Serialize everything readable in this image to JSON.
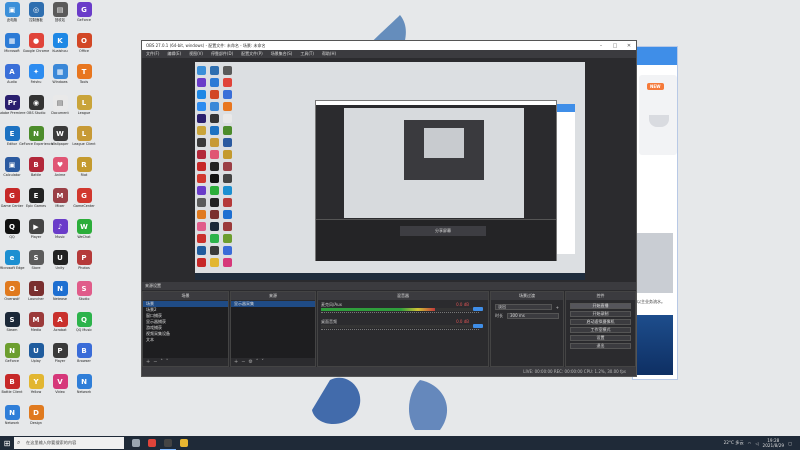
{
  "desktop": {
    "icons": [
      {
        "label": "此电脑",
        "color": "#3b8fd9",
        "glyph": "▣"
      },
      {
        "label": "控制面板",
        "color": "#2f6fb0",
        "glyph": "◎"
      },
      {
        "label": "回收站",
        "color": "#5a5a5a",
        "glyph": "▤"
      },
      {
        "label": "GeForce",
        "color": "#6a3cc9",
        "glyph": "G"
      },
      {
        "label": "Microsoft",
        "color": "#2c7bd6",
        "glyph": "▦"
      },
      {
        "label": "Google Chrome",
        "color": "#e0443a",
        "glyph": "●"
      },
      {
        "label": "Kuaishou",
        "color": "#1e88e5",
        "glyph": "K"
      },
      {
        "label": "Office",
        "color": "#d24726",
        "glyph": "O"
      },
      {
        "label": "Audio",
        "color": "#3a6fd8",
        "glyph": "A"
      },
      {
        "label": "Feishu",
        "color": "#2d8cf0",
        "glyph": "✦"
      },
      {
        "label": "Windows",
        "color": "#3a88d8",
        "glyph": "▦"
      },
      {
        "label": "Tools",
        "color": "#e8761f",
        "glyph": "T"
      },
      {
        "label": "Adobe Premiere",
        "color": "#2a1f6e",
        "glyph": "Pr"
      },
      {
        "label": "OBS Studio",
        "color": "#333333",
        "glyph": "◉"
      },
      {
        "label": "Document",
        "color": "#e9e9e9",
        "glyph": "▤"
      },
      {
        "label": "League",
        "color": "#c9a43a",
        "glyph": "L"
      },
      {
        "label": "Editor",
        "color": "#1d72c2",
        "glyph": "E"
      },
      {
        "label": "GeForce Experience",
        "color": "#4c8c2b",
        "glyph": "N"
      },
      {
        "label": "Wallpaper",
        "color": "#3a3a3a",
        "glyph": "W"
      },
      {
        "label": "League Client",
        "color": "#c79a36",
        "glyph": "L"
      },
      {
        "label": "Calculator",
        "color": "#2b5aa0",
        "glyph": "▣"
      },
      {
        "label": "Battle",
        "color": "#b2283a",
        "glyph": "B"
      },
      {
        "label": "Anime",
        "color": "#e05574",
        "glyph": "♥"
      },
      {
        "label": "Riot",
        "color": "#c49a2e",
        "glyph": "R"
      },
      {
        "label": "Game Center",
        "color": "#c62828",
        "glyph": "G"
      },
      {
        "label": "Epic Games",
        "color": "#222222",
        "glyph": "E"
      },
      {
        "label": "Mixer",
        "color": "#9b3f46",
        "glyph": "M"
      },
      {
        "label": "GameCenter",
        "color": "#d1382e",
        "glyph": "G"
      },
      {
        "label": "QQ",
        "color": "#111111",
        "glyph": "Q"
      },
      {
        "label": "Player",
        "color": "#444444",
        "glyph": "▶"
      },
      {
        "label": "Music",
        "color": "#6a3cc9",
        "glyph": "♪"
      },
      {
        "label": "WeChat",
        "color": "#2bad3a",
        "glyph": "W"
      },
      {
        "label": "Microsoft Edge",
        "color": "#1c8fd1",
        "glyph": "e"
      },
      {
        "label": "Store",
        "color": "#5b5b5b",
        "glyph": "S"
      },
      {
        "label": "Unity",
        "color": "#222222",
        "glyph": "U"
      },
      {
        "label": "Photos",
        "color": "#b53a3a",
        "glyph": "P"
      },
      {
        "label": "Overwolf",
        "color": "#e07a1f",
        "glyph": "O"
      },
      {
        "label": "Launcher",
        "color": "#7a2f2f",
        "glyph": "L"
      },
      {
        "label": "Netease",
        "color": "#1e6fd1",
        "glyph": "N"
      },
      {
        "label": "Studio",
        "color": "#e05c8a",
        "glyph": "S"
      },
      {
        "label": "Steam",
        "color": "#1b2838",
        "glyph": "S"
      },
      {
        "label": "Media",
        "color": "#9b3a3a",
        "glyph": "M"
      },
      {
        "label": "Acrobat",
        "color": "#c9302c",
        "glyph": "A"
      },
      {
        "label": "QQ Music",
        "color": "#2cb34b",
        "glyph": "Q"
      },
      {
        "label": "GeForce",
        "color": "#6c9e2f",
        "glyph": "N"
      },
      {
        "label": "Uplay",
        "color": "#1f5c9e",
        "glyph": "U"
      },
      {
        "label": "Player",
        "color": "#3a3a3a",
        "glyph": "P"
      },
      {
        "label": "Browser",
        "color": "#3a6cd8",
        "glyph": "B"
      },
      {
        "label": "Battle Client",
        "color": "#c62828",
        "glyph": "B"
      },
      {
        "label": "Yellow",
        "color": "#e2b631",
        "glyph": "Y"
      },
      {
        "label": "Video",
        "color": "#d6387a",
        "glyph": "V"
      },
      {
        "label": "Network",
        "color": "#2f7ed8",
        "glyph": "N"
      },
      {
        "label": "Network",
        "color": "#2f7ed8",
        "glyph": "N"
      },
      {
        "label": "Design",
        "color": "#e07a1f",
        "glyph": "D"
      }
    ]
  },
  "bg_window": {
    "tag": "NEW",
    "text": "以主业务流水。"
  },
  "obs": {
    "title": "OBS 27.0.1 (64-bit, windows) - 配置文件: 未命名 - 场景: 未命名",
    "menu": [
      "文件(F)",
      "编辑(E)",
      "视图(V)",
      "停靠部件(D)",
      "配置文件(P)",
      "场景集合(S)",
      "工具(T)",
      "帮助(H)"
    ],
    "nested_label": "分享屏幕",
    "dock_title": "来源设置",
    "docks": {
      "scenes": {
        "title": "场景",
        "items": [
          "场景",
          "场景2",
          "窗口捕获",
          "显示器捕获",
          "游戏捕获",
          "视频采集设备",
          "文本"
        ],
        "selected": 0
      },
      "sources": {
        "title": "来源",
        "items": [
          "显示器采集"
        ],
        "selected": 0
      },
      "mixer": {
        "title": "混音器",
        "channels": [
          {
            "name": "麦克风/Aux",
            "db": "0.0 dB",
            "level": 0.72
          },
          {
            "name": "桌面音频",
            "db": "0.0 dB",
            "level": 0.0
          }
        ]
      },
      "transitions": {
        "title": "场景过渡",
        "type": "淡出",
        "duration_label": "时长",
        "duration": "300 ms"
      },
      "controls": {
        "title": "控件",
        "buttons": [
          "开始直播",
          "开始录制",
          "启动虚拟摄像机",
          "工作室模式",
          "设置",
          "退出"
        ],
        "active": 0
      }
    },
    "status": "LIVE: 00:00:00   REC: 00:00:00   CPU: 1.2%, 30.00 fps"
  },
  "taskbar": {
    "search_placeholder": "在这里输入你要搜索的内容",
    "apps": [
      {
        "name": "task-view-icon",
        "color": "#9aa5b1"
      },
      {
        "name": "chrome-icon",
        "color": "#e0443a"
      },
      {
        "name": "obs-icon",
        "color": "#444444"
      },
      {
        "name": "explorer-icon",
        "color": "#e8b631"
      }
    ],
    "weather": "22°C 多云",
    "time": "19:28",
    "date": "2021/8/29"
  }
}
